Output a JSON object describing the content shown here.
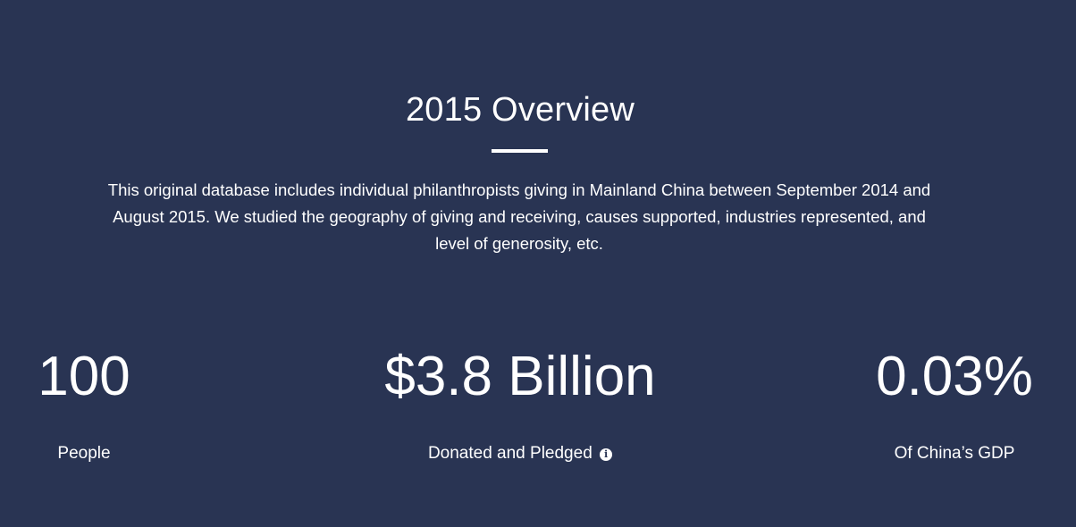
{
  "overview": {
    "title": "2015 Overview",
    "description": "This original database includes individual philanthropists giving in Mainland China between September 2014 and August 2015. We studied the geography of giving and receiving, causes supported, industries represented, and level of generosity, etc."
  },
  "stats": [
    {
      "value": "100",
      "label": "People"
    },
    {
      "value": "$3.8 Billion",
      "label": "Donated and Pledged",
      "icon": "info-icon"
    },
    {
      "value": "0.03%",
      "label": "Of China’s GDP"
    }
  ],
  "colors": {
    "background": "#293453",
    "text": "#ffffff"
  }
}
